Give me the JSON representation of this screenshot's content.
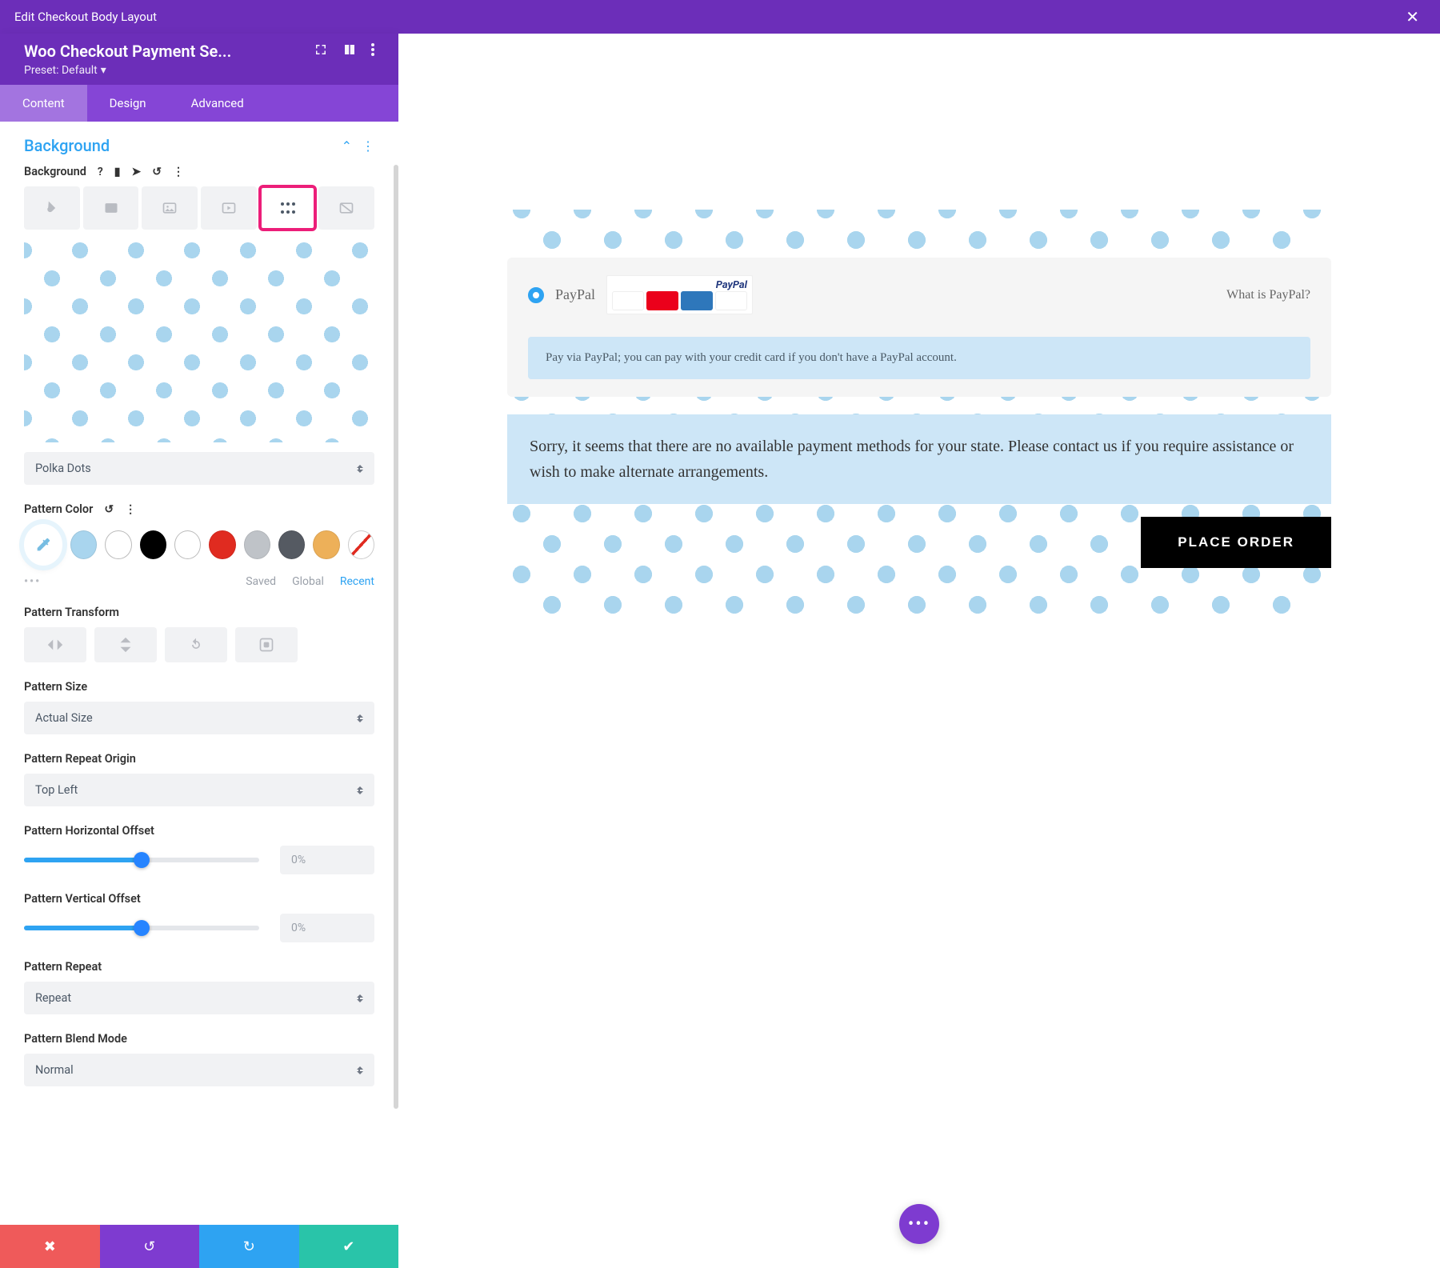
{
  "topbar": {
    "title": "Edit Checkout Body Layout"
  },
  "module": {
    "title": "Woo Checkout Payment Se...",
    "preset": "Preset: Default"
  },
  "tabs": {
    "content": "Content",
    "design": "Design",
    "advanced": "Advanced"
  },
  "section": {
    "title": "Background"
  },
  "background": {
    "label": "Background",
    "pattern_select": "Polka Dots",
    "color_label": "Pattern Color",
    "palette_tabs": {
      "saved": "Saved",
      "global": "Global",
      "recent": "Recent"
    },
    "transform_label": "Pattern Transform",
    "size_label": "Pattern Size",
    "size_value": "Actual Size",
    "origin_label": "Pattern Repeat Origin",
    "origin_value": "Top Left",
    "hoff_label": "Pattern Horizontal Offset",
    "hoff_value": "0%",
    "voff_label": "Pattern Vertical Offset",
    "voff_value": "0%",
    "repeat_label": "Pattern Repeat",
    "repeat_value": "Repeat",
    "blend_label": "Pattern Blend Mode",
    "blend_value": "Normal",
    "swatches": [
      "#a9d5ee",
      "#ffffff",
      "#000000",
      "#ffffff",
      "#e02b20",
      "#bfc3c8",
      "#555a62",
      "#edb059"
    ]
  },
  "checkout": {
    "paypal_label": "PayPal",
    "paypal_brand": "PayPal",
    "what_is": "What is PayPal?",
    "pay_via": "Pay via PayPal; you can pay with your credit card if you don't have a PayPal account.",
    "sorry": "Sorry, it seems that there are no available payment methods for your state. Please contact us if you require assistance or wish to make alternate arrangements.",
    "place_order": "PLACE ORDER"
  }
}
